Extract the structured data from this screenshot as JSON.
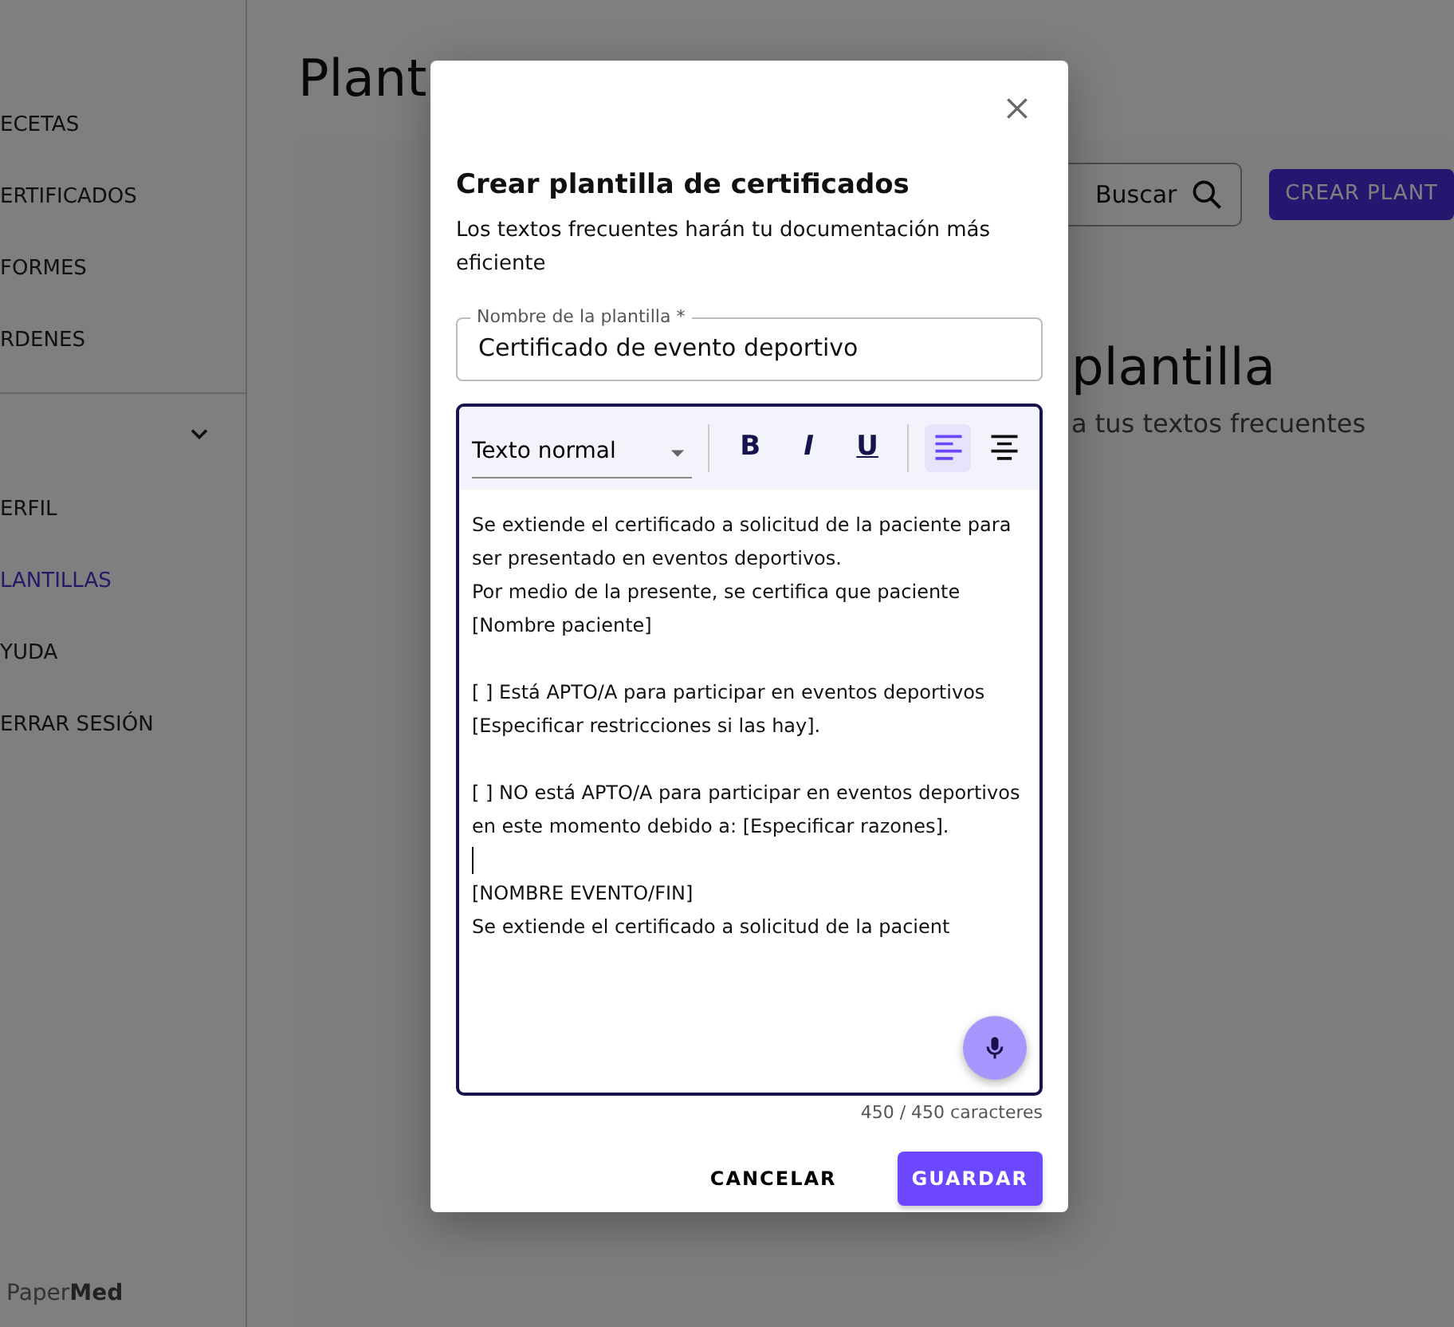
{
  "sidebar": {
    "items": [
      {
        "label": "ECETAS",
        "selected": false
      },
      {
        "label": "ERTIFICADOS",
        "selected": false
      },
      {
        "label": "FORMES",
        "selected": false
      },
      {
        "label": "RDENES",
        "selected": false
      }
    ],
    "account_items": [
      {
        "label": "ERFIL",
        "selected": false
      },
      {
        "label": "LANTILLAS",
        "selected": true
      },
      {
        "label": "YUDA",
        "selected": false
      },
      {
        "label": "ERRAR SESIÓN",
        "selected": false
      }
    ],
    "logo": {
      "light": "Paper",
      "bold": "Med"
    }
  },
  "page": {
    "title": "Plant",
    "search": {
      "placeholder": "Buscar"
    },
    "create_button": "CREAR PLANT",
    "empty_title": "plantilla",
    "empty_subtitle": "a tus textos frecuentes"
  },
  "dialog": {
    "title": "Crear plantilla de certificados",
    "subtitle": "Los textos frecuentes harán tu documentación más eficiente",
    "name_field": {
      "label": "Nombre de la plantilla *",
      "value": "Certificado de evento deportivo"
    },
    "toolbar": {
      "style_select": "Texto normal",
      "format_buttons": [
        {
          "kind": "bold",
          "label": "B"
        },
        {
          "kind": "italic",
          "label": "I"
        },
        {
          "kind": "underline",
          "label": "U"
        }
      ],
      "align_buttons": [
        {
          "kind": "left",
          "selected": true
        },
        {
          "kind": "center",
          "selected": false
        }
      ]
    },
    "blocks": [
      {
        "kind": "paragraph",
        "lines": [
          "Se extiende el certificado a solicitud de la paciente para ser presentado en eventos deportivos.",
          "Por medio de la presente, se certifica que paciente [Nombre paciente]"
        ]
      },
      {
        "kind": "blank"
      },
      {
        "kind": "paragraph",
        "lines": [
          "[ ] Está APTO/A para participar en eventos deportivos [Especificar restricciones si las hay]."
        ]
      },
      {
        "kind": "blank"
      },
      {
        "kind": "paragraph",
        "lines": [
          "[ ] NO está APTO/A para participar en eventos deportivos en este momento debido a: [Especificar razones]."
        ]
      },
      {
        "kind": "cursor"
      },
      {
        "kind": "paragraph",
        "lines": [
          "[NOMBRE EVENTO/FIN]",
          "Se extiende el certificado a solicitud de la pacient"
        ]
      }
    ],
    "counter": "450 / 450 caracteres",
    "buttons": [
      {
        "kind": "text",
        "label": "CANCELAR"
      },
      {
        "kind": "primary",
        "label": "GUARDAR"
      }
    ]
  }
}
